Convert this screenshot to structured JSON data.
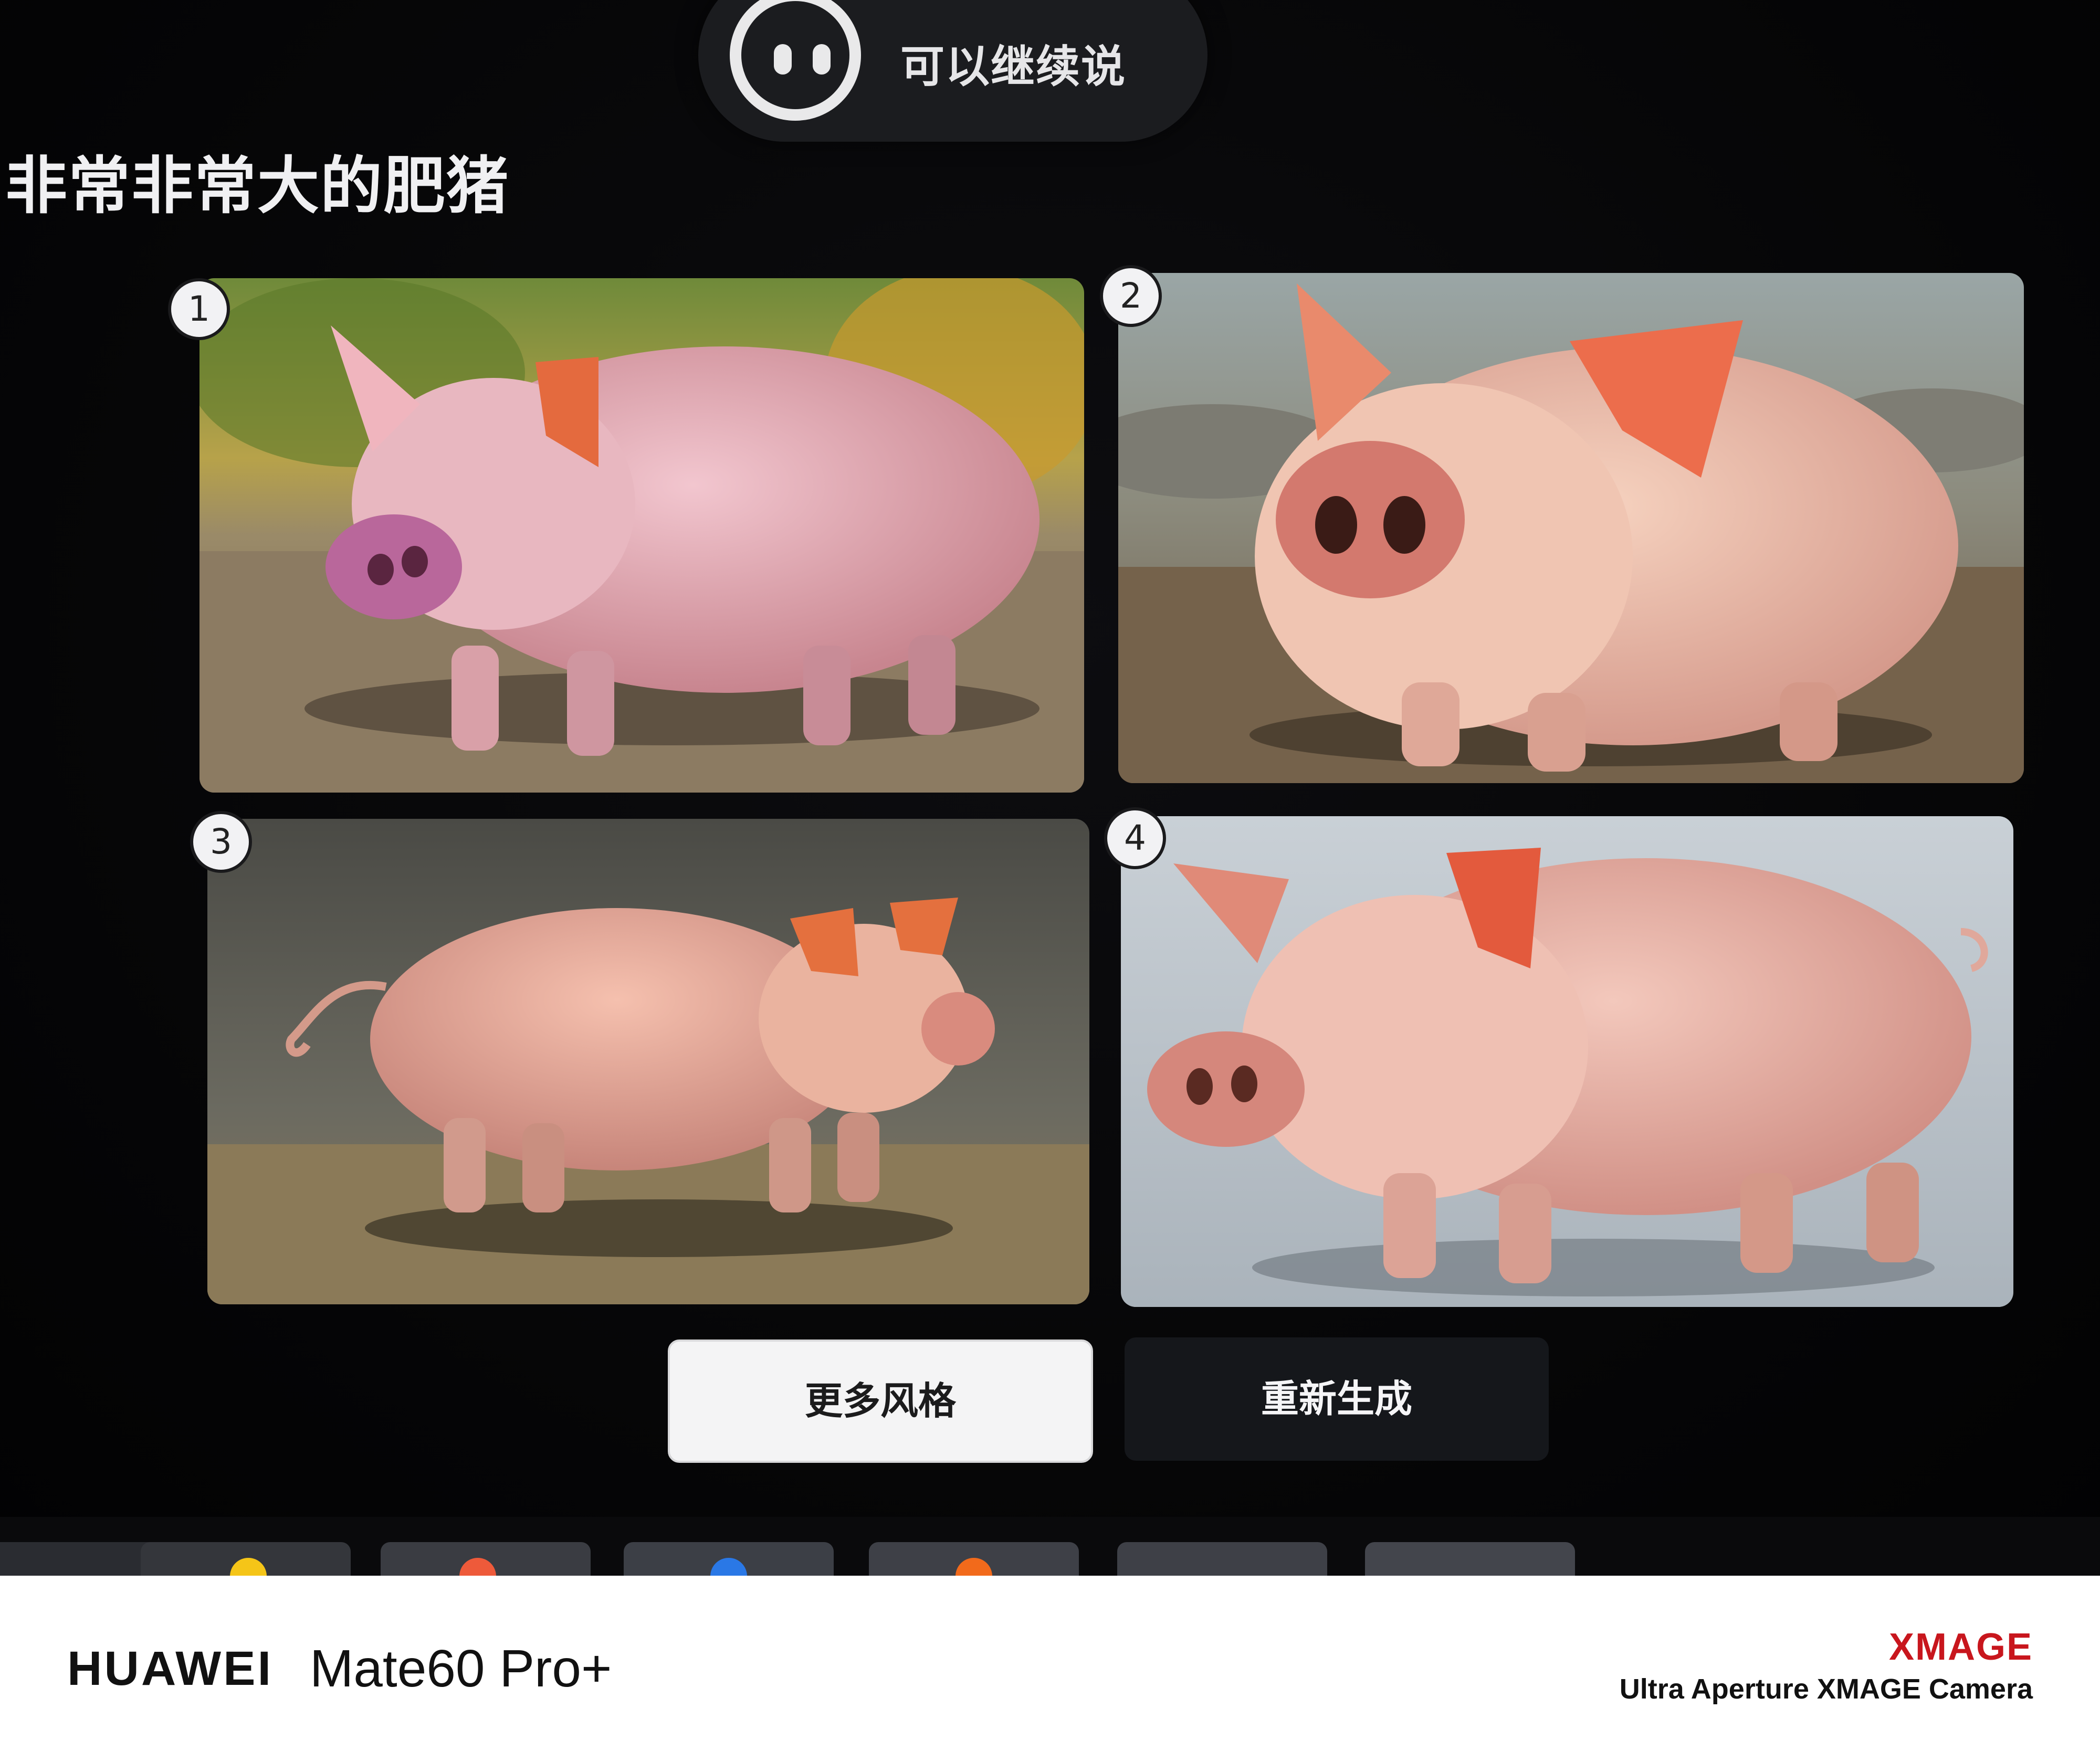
{
  "assistant": {
    "voice_hint": "可以继续说",
    "face_icon": "assistant-face-icon"
  },
  "prompt": {
    "title": "非常非常大的肥猪"
  },
  "images": [
    {
      "index": "1",
      "subject": "pig"
    },
    {
      "index": "2",
      "subject": "pig"
    },
    {
      "index": "3",
      "subject": "pig"
    },
    {
      "index": "4",
      "subject": "pig"
    }
  ],
  "actions": {
    "more_styles": "更多风格",
    "regenerate": "重新生成"
  },
  "footer": {
    "brand": "HUAWEI",
    "model": "Mate60 Pro+",
    "xmage": "XMAGE",
    "camera": "Ultra Aperture XMAGE Camera"
  },
  "colors": {
    "background": "#050506",
    "accent_red": "#c8161d",
    "button_light": "#f4f4f5",
    "button_dark": "#15171b"
  }
}
